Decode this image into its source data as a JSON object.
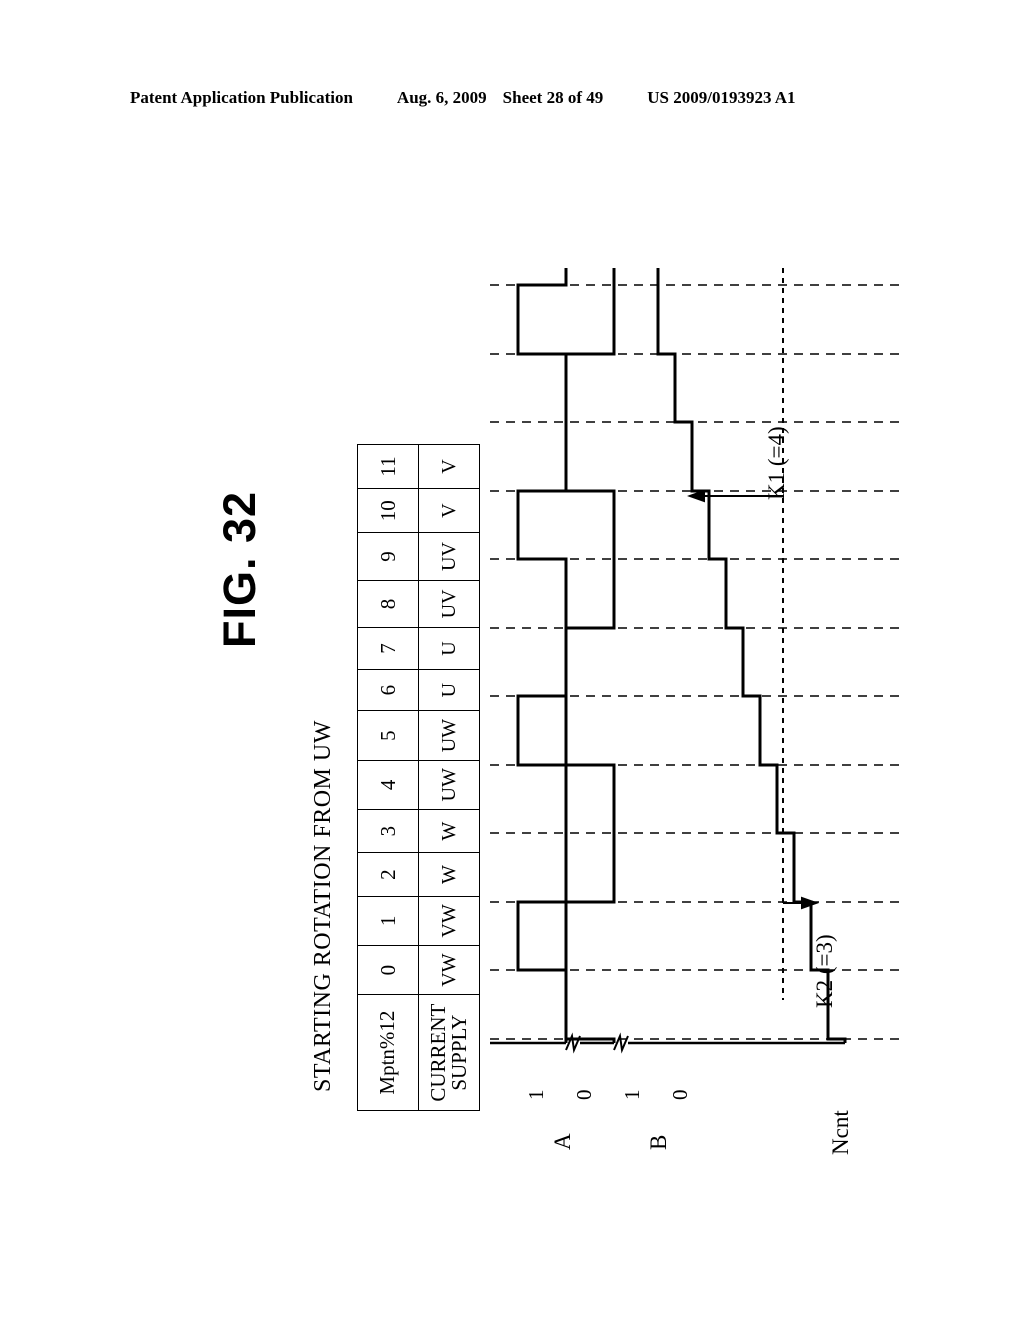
{
  "header": {
    "publication": "Patent Application Publication",
    "date": "Aug. 6, 2009",
    "sheet": "Sheet 28 of 49",
    "patent_number": "US 2009/0193923 A1"
  },
  "figure": {
    "title": "FIG. 32",
    "subtitle": "STARTING ROTATION FROM UW"
  },
  "table": {
    "row_headers": {
      "pattern": "Mptn%12",
      "supply_line1": "CURRENT",
      "supply_line2": "SUPPLY"
    },
    "pattern_values": [
      "0",
      "1",
      "2",
      "3",
      "4",
      "5",
      "6",
      "7",
      "8",
      "9",
      "10",
      "11"
    ],
    "current_supply": [
      "VW",
      "VW",
      "W",
      "W",
      "UW",
      "UW",
      "U",
      "U",
      "UV",
      "UV",
      "V",
      "V"
    ]
  },
  "signals": {
    "a": {
      "name": "A",
      "high_label": "1",
      "low_label": "0"
    },
    "b": {
      "name": "B",
      "high_label": "1",
      "low_label": "0"
    },
    "ncnt": {
      "name": "Ncnt"
    }
  },
  "annotations": {
    "k1": "K1 (=4)",
    "k2": "K2 (=3)"
  },
  "chart_data": {
    "type": "line",
    "title": "FIG. 32 STARTING ROTATION FROM UW",
    "xlabel": "Mptn%12",
    "ylabel": "",
    "x": [
      0,
      1,
      2,
      3,
      4,
      5,
      6,
      7,
      8,
      9,
      10,
      11
    ],
    "grid": true,
    "legend": "none",
    "series": [
      {
        "name": "A",
        "type": "digital",
        "values": [
          0,
          1,
          1,
          0,
          0,
          1,
          1,
          0,
          0,
          1,
          1,
          0
        ]
      },
      {
        "name": "B",
        "type": "digital",
        "values": [
          1,
          1,
          0,
          0,
          1,
          1,
          0,
          0,
          1,
          1,
          0,
          0
        ]
      },
      {
        "name": "Ncnt",
        "type": "staircase",
        "values": [
          0,
          1,
          2,
          3,
          4,
          5,
          6,
          7,
          8,
          9,
          10,
          11
        ]
      }
    ],
    "markers": [
      {
        "label": "K1 (=4)",
        "value": 4
      },
      {
        "label": "K2 (=3)",
        "value": 3
      }
    ]
  },
  "colors": {
    "ink": "#000000",
    "paper": "#ffffff"
  }
}
